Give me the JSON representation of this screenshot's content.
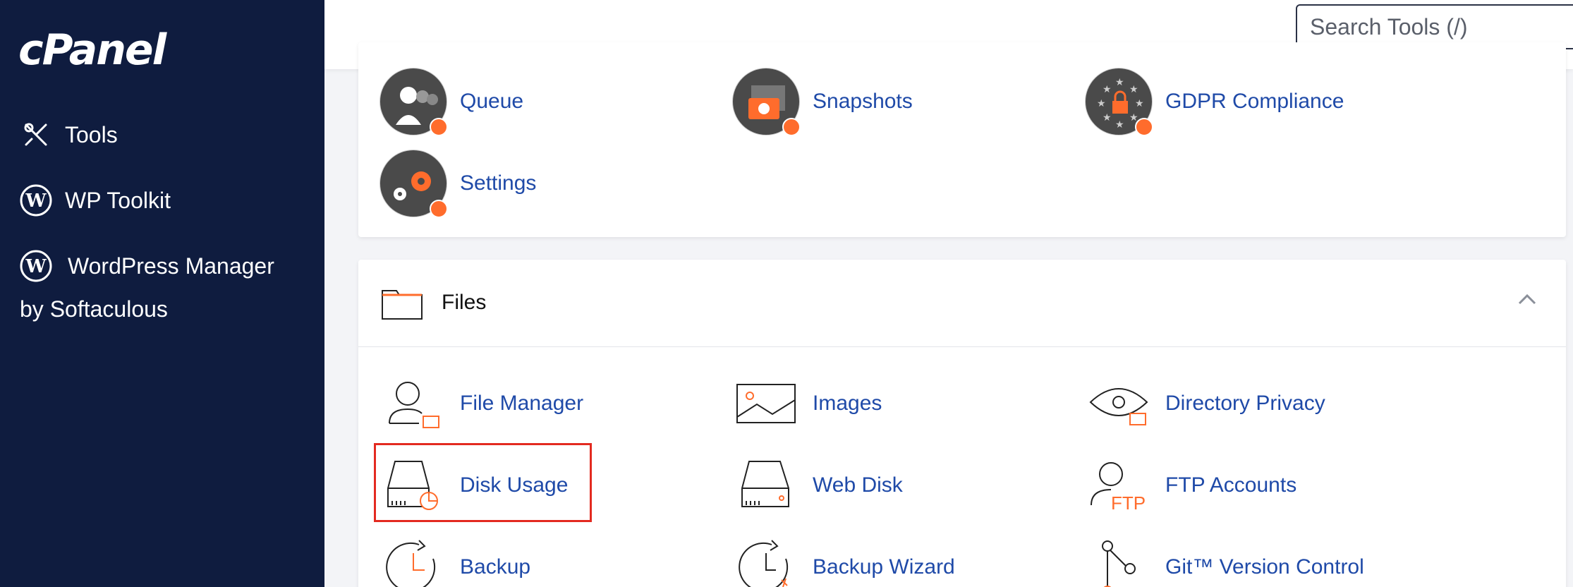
{
  "app": {
    "logo": "cPanel"
  },
  "sidebar": {
    "items": [
      {
        "label": "Tools",
        "icon": "tools-icon"
      },
      {
        "label": "WP Toolkit",
        "icon": "wordpress-icon"
      },
      {
        "label": "WordPress Manager",
        "icon": "wordpress-icon"
      }
    ],
    "wpm_sub": "by Softaculous"
  },
  "header": {
    "search_placeholder": "Search Tools (/)"
  },
  "top_section": {
    "items": [
      {
        "label": "Queue",
        "icon": "queue-icon"
      },
      {
        "label": "Snapshots",
        "icon": "snapshot-camera-icon"
      },
      {
        "label": "GDPR Compliance",
        "icon": "gdpr-lock-icon"
      },
      {
        "label": "Settings",
        "icon": "settings-gear-icon"
      }
    ]
  },
  "files_section": {
    "title": "Files",
    "items": [
      {
        "label": "File Manager",
        "icon": "file-manager-icon"
      },
      {
        "label": "Images",
        "icon": "image-icon"
      },
      {
        "label": "Directory Privacy",
        "icon": "eye-icon"
      },
      {
        "label": "Disk Usage",
        "icon": "disk-usage-icon"
      },
      {
        "label": "Web Disk",
        "icon": "web-disk-icon"
      },
      {
        "label": "FTP Accounts",
        "icon": "ftp-user-icon"
      },
      {
        "label": "Backup",
        "icon": "backup-clock-icon"
      },
      {
        "label": "Backup Wizard",
        "icon": "backup-wizard-icon"
      },
      {
        "label": "Git™ Version Control",
        "icon": "git-icon"
      }
    ]
  },
  "colors": {
    "sidebar": "#0f1c3f",
    "link": "#1f4aa8",
    "accent": "#ff6c2c",
    "highlight": "#e32a20"
  }
}
